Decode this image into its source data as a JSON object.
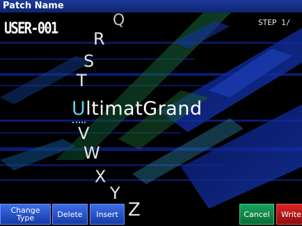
{
  "title_bar": "Patch Name",
  "patch_id": "USER-001",
  "step": "STEP 1/",
  "patch_name": {
    "cursor_char": "U",
    "rest": "ltimatGrand"
  },
  "char_selector": [
    "Q",
    "R",
    "S",
    "T",
    "V",
    "W",
    "X",
    "Y",
    "Z"
  ],
  "buttons": {
    "change_type": [
      "Change",
      "Type"
    ],
    "delete": "Delete",
    "insert": "Insert",
    "cancel": "Cancel",
    "write": "Write"
  },
  "colors": {
    "title_bar": "#1c3a9a",
    "cursor": "#5fd0e8",
    "button_blue": "#2a54d0",
    "button_green": "#139050",
    "button_red": "#c81a1a"
  }
}
